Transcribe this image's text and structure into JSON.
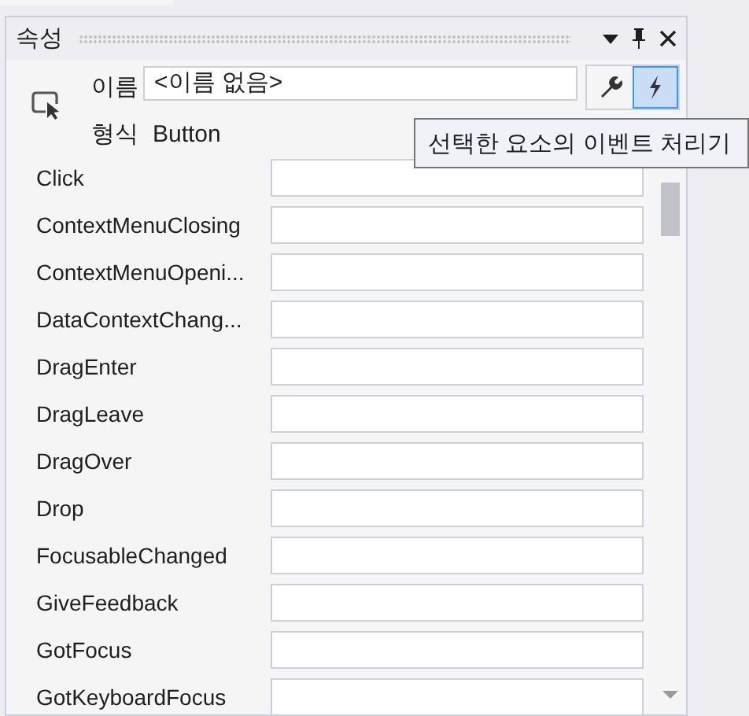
{
  "panel": {
    "title": "속성"
  },
  "name_label": "이름",
  "name_value": "<이름 없음>",
  "view_buttons": [
    {
      "kind": "properties",
      "selected": false
    },
    {
      "kind": "events",
      "selected": true
    }
  ],
  "type_label": "형식",
  "type_value": "Button",
  "tooltip": "선택한 요소의 이벤트 처리기",
  "events": [
    {
      "name": "Click"
    },
    {
      "name": "ContextMenuClosing"
    },
    {
      "name": "ContextMenuOpeni..."
    },
    {
      "name": "DataContextChang..."
    },
    {
      "name": "DragEnter"
    },
    {
      "name": "DragLeave"
    },
    {
      "name": "DragOver"
    },
    {
      "name": "Drop"
    },
    {
      "name": "FocusableChanged"
    },
    {
      "name": "GiveFeedback"
    },
    {
      "name": "GotFocus"
    },
    {
      "name": "GotKeyboardFocus"
    }
  ]
}
